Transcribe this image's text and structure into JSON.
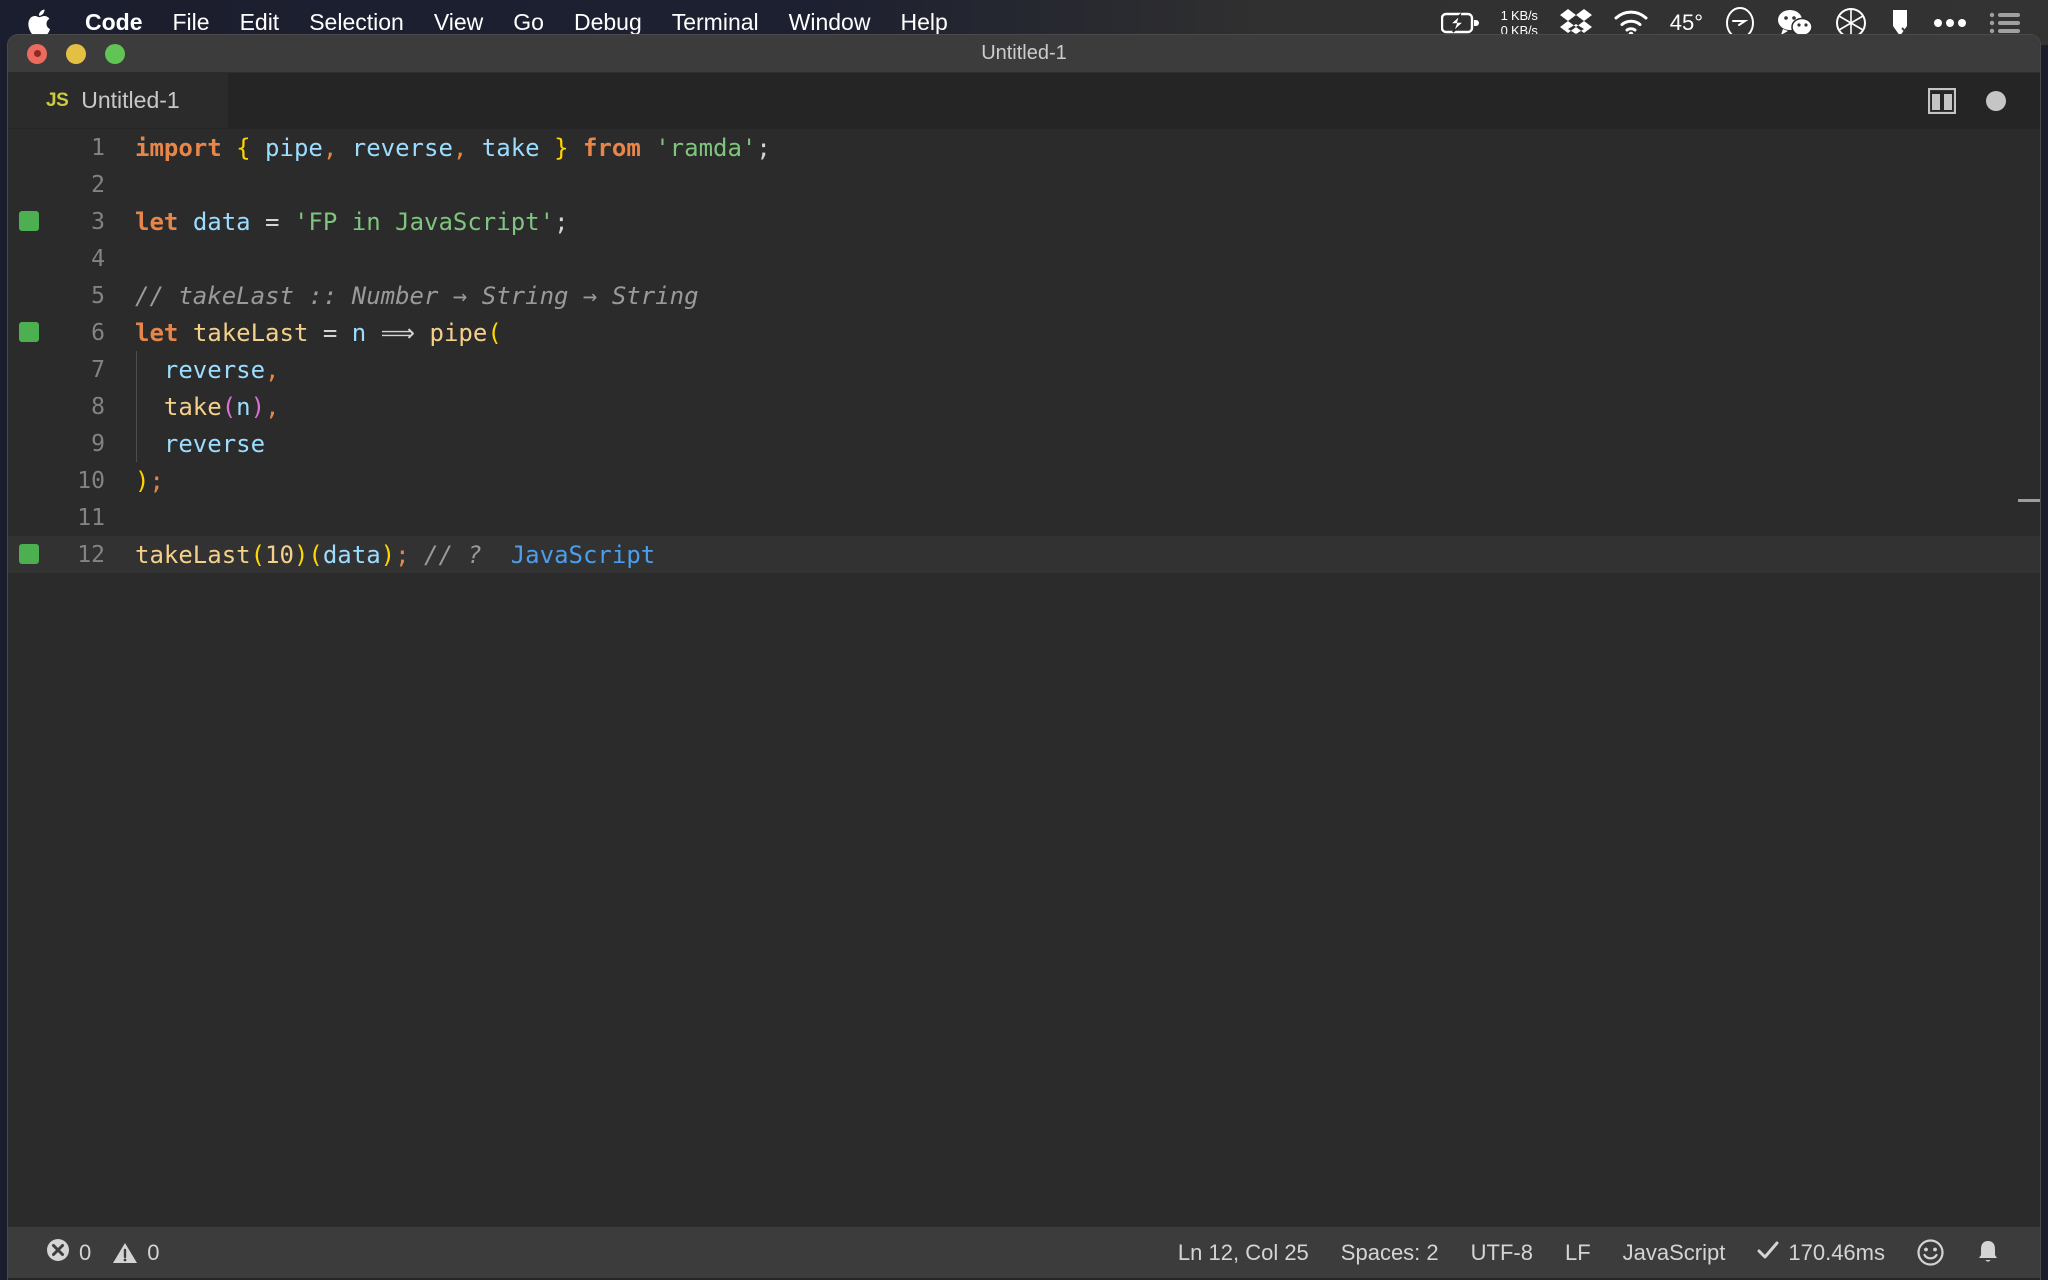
{
  "menubar": {
    "apple_icon": "apple-logo-icon",
    "items": [
      {
        "label": "Code",
        "bold": true
      },
      {
        "label": "File",
        "bold": false
      },
      {
        "label": "Edit",
        "bold": false
      },
      {
        "label": "Selection",
        "bold": false
      },
      {
        "label": "View",
        "bold": false
      },
      {
        "label": "Go",
        "bold": false
      },
      {
        "label": "Debug",
        "bold": false
      },
      {
        "label": "Terminal",
        "bold": false
      },
      {
        "label": "Window",
        "bold": false
      },
      {
        "label": "Help",
        "bold": false
      }
    ],
    "status": {
      "battery_icon": "battery-charging-icon",
      "network_up": "1 KB/s",
      "network_down": "0 KB/s",
      "dropbox_icon": "dropbox-icon",
      "wifi_icon": "wifi-icon",
      "temperature": "45°",
      "clock_icon": "clock-circle-icon",
      "wechat_icon": "wechat-icon",
      "aperture_icon": "camera-aperture-icon",
      "pen_icon": "pen-shape-icon",
      "more_icon": "ellipsis-icon",
      "control_center_icon": "list-lines-icon"
    }
  },
  "window": {
    "title": "Untitled-1",
    "traffic_lights": [
      "close-button",
      "minimize-button",
      "maximize-button"
    ]
  },
  "tab": {
    "file_type_badge": "JS",
    "label": "Untitled-1",
    "split_editor_icon": "split-editor-icon",
    "dirty_indicator": "unsaved-changes-dot"
  },
  "editor": {
    "lines": [
      {
        "num": "1",
        "marker": false,
        "current": false,
        "indent_guide": false,
        "tokens": [
          {
            "t": "import",
            "c": "t-kw"
          },
          {
            "t": " ",
            "c": "t-plain"
          },
          {
            "t": "{",
            "c": "t-brace"
          },
          {
            "t": " pipe",
            "c": "t-var"
          },
          {
            "t": ",",
            "c": "t-punct"
          },
          {
            "t": " reverse",
            "c": "t-var"
          },
          {
            "t": ",",
            "c": "t-punct"
          },
          {
            "t": " take ",
            "c": "t-var"
          },
          {
            "t": "}",
            "c": "t-brace"
          },
          {
            "t": " ",
            "c": "t-plain"
          },
          {
            "t": "from",
            "c": "t-kw"
          },
          {
            "t": " ",
            "c": "t-plain"
          },
          {
            "t": "'ramda'",
            "c": "t-str"
          },
          {
            "t": ";",
            "c": "t-plain"
          }
        ]
      },
      {
        "num": "2",
        "marker": false,
        "current": false,
        "indent_guide": false,
        "tokens": []
      },
      {
        "num": "3",
        "marker": true,
        "current": false,
        "indent_guide": false,
        "tokens": [
          {
            "t": "let",
            "c": "t-kw"
          },
          {
            "t": " ",
            "c": "t-plain"
          },
          {
            "t": "data",
            "c": "t-var"
          },
          {
            "t": " = ",
            "c": "t-plain"
          },
          {
            "t": "'FP in JavaScript'",
            "c": "t-str"
          },
          {
            "t": ";",
            "c": "t-plain"
          }
        ]
      },
      {
        "num": "4",
        "marker": false,
        "current": false,
        "indent_guide": false,
        "tokens": []
      },
      {
        "num": "5",
        "marker": false,
        "current": false,
        "indent_guide": false,
        "tokens": [
          {
            "t": "// takeLast :: Number → String → String",
            "c": "t-cmt"
          }
        ]
      },
      {
        "num": "6",
        "marker": true,
        "current": false,
        "indent_guide": false,
        "tokens": [
          {
            "t": "let",
            "c": "t-kw"
          },
          {
            "t": " ",
            "c": "t-plain"
          },
          {
            "t": "takeLast",
            "c": "t-fn"
          },
          {
            "t": " = ",
            "c": "t-plain"
          },
          {
            "t": "n",
            "c": "t-var"
          },
          {
            "t": " ⟹ ",
            "c": "t-plain"
          },
          {
            "t": "pipe",
            "c": "t-fn"
          },
          {
            "t": "(",
            "c": "t-brace"
          }
        ]
      },
      {
        "num": "7",
        "marker": false,
        "current": false,
        "indent_guide": true,
        "tokens": [
          {
            "t": "  reverse",
            "c": "t-var"
          },
          {
            "t": ",",
            "c": "t-punct"
          }
        ]
      },
      {
        "num": "8",
        "marker": false,
        "current": false,
        "indent_guide": true,
        "tokens": [
          {
            "t": "  ",
            "c": "t-plain"
          },
          {
            "t": "take",
            "c": "t-fn"
          },
          {
            "t": "(",
            "c": "t-brace2"
          },
          {
            "t": "n",
            "c": "t-var"
          },
          {
            "t": ")",
            "c": "t-brace2"
          },
          {
            "t": ",",
            "c": "t-punct"
          }
        ]
      },
      {
        "num": "9",
        "marker": false,
        "current": false,
        "indent_guide": true,
        "tokens": [
          {
            "t": "  reverse",
            "c": "t-var"
          }
        ]
      },
      {
        "num": "10",
        "marker": false,
        "current": false,
        "indent_guide": false,
        "tokens": [
          {
            "t": ")",
            "c": "t-brace"
          },
          {
            "t": ";",
            "c": "t-punct"
          }
        ]
      },
      {
        "num": "11",
        "marker": false,
        "current": false,
        "indent_guide": false,
        "tokens": []
      },
      {
        "num": "12",
        "marker": true,
        "current": true,
        "indent_guide": false,
        "tokens": [
          {
            "t": "takeLast",
            "c": "t-fn"
          },
          {
            "t": "(",
            "c": "t-brace"
          },
          {
            "t": "10",
            "c": "t-num"
          },
          {
            "t": ")",
            "c": "t-brace"
          },
          {
            "t": "(",
            "c": "t-brace"
          },
          {
            "t": "data",
            "c": "t-var"
          },
          {
            "t": ")",
            "c": "t-brace"
          },
          {
            "t": ";",
            "c": "t-punct"
          },
          {
            "t": " // ?  ",
            "c": "t-cmt"
          },
          {
            "t": "JavaScript",
            "c": "t-quokka"
          }
        ]
      }
    ]
  },
  "statusbar": {
    "errors_icon": "error-circle-icon",
    "errors_count": "0",
    "warnings_icon": "warning-triangle-icon",
    "warnings_count": "0",
    "cursor_position": "Ln 12, Col 25",
    "indentation": "Spaces: 2",
    "encoding": "UTF-8",
    "eol": "LF",
    "language": "JavaScript",
    "quokka_check_icon": "check-icon",
    "quokka_time": "170.46ms",
    "feedback_icon": "smiley-icon",
    "notifications_icon": "bell-icon"
  },
  "colors": {
    "menubar_bg": "#1d2030",
    "titlebar_bg": "#3c3c3c",
    "editor_bg": "#2b2b2b",
    "statusbar_bg": "#3c3c3c",
    "marker_green": "#4caf50",
    "js_yellow": "#cbcb41",
    "quokka_blue": "#4a9eed"
  }
}
